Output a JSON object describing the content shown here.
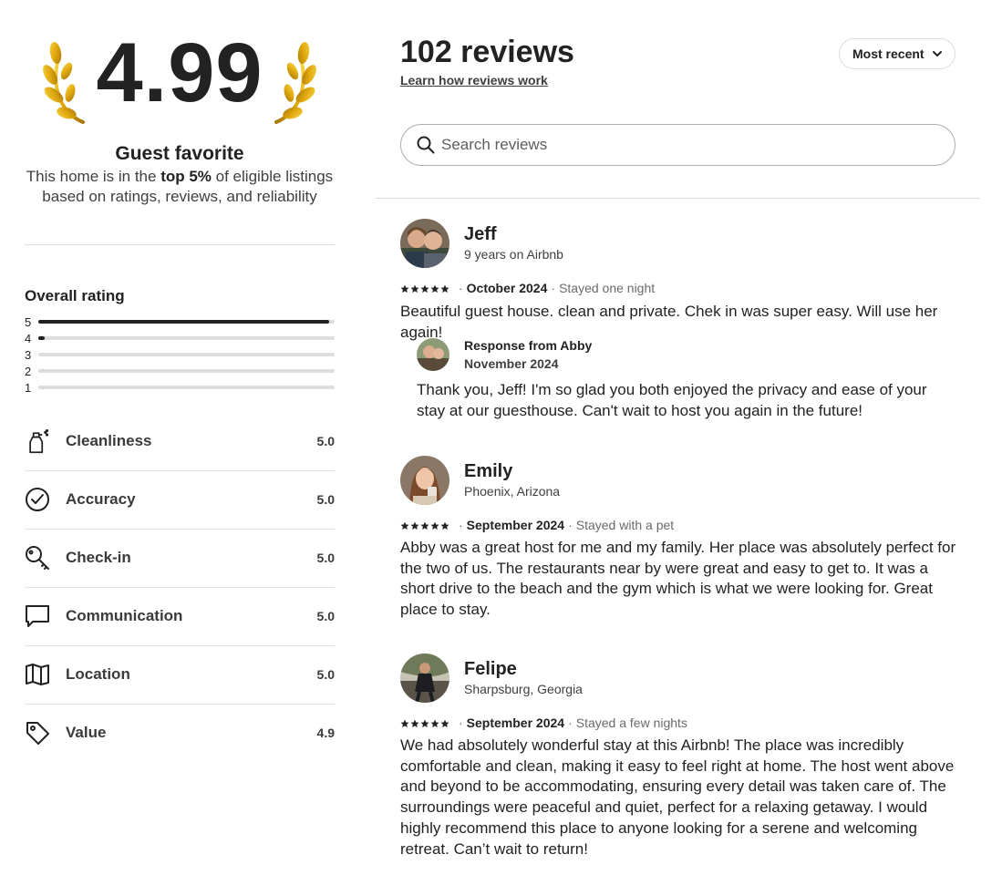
{
  "summary": {
    "rating": "4.99",
    "title": "Guest favorite",
    "desc_part1": "This home is in the ",
    "desc_bold": "top 5%",
    "desc_part2": " of eligible listings based on ratings, reviews, and reliability"
  },
  "overall": {
    "title": "Overall rating",
    "bars": [
      {
        "label": "5",
        "fraction": 0.98
      },
      {
        "label": "4",
        "fraction": 0.02
      },
      {
        "label": "3",
        "fraction": 0
      },
      {
        "label": "2",
        "fraction": 0
      },
      {
        "label": "1",
        "fraction": 0
      }
    ]
  },
  "categories": [
    {
      "label": "Cleanliness",
      "value": "5.0",
      "icon": "spray-bottle-icon"
    },
    {
      "label": "Accuracy",
      "value": "5.0",
      "icon": "check-circle-icon"
    },
    {
      "label": "Check-in",
      "value": "5.0",
      "icon": "key-icon"
    },
    {
      "label": "Communication",
      "value": "5.0",
      "icon": "chat-bubble-icon"
    },
    {
      "label": "Location",
      "value": "5.0",
      "icon": "map-icon"
    },
    {
      "label": "Value",
      "value": "4.9",
      "icon": "tag-icon"
    }
  ],
  "header": {
    "count": "102 reviews",
    "learn_link": "Learn how reviews work",
    "sort_label": "Most recent"
  },
  "search": {
    "placeholder": "Search reviews"
  },
  "reviews": [
    {
      "name": "Jeff",
      "sub": "9 years on Airbnb",
      "date": "October 2024",
      "stay": "Stayed one night",
      "text": "Beautiful guest house. clean and private. Chek in was super easy. Will use her again!",
      "response": {
        "from": "Response from Abby",
        "date": "November 2024",
        "text": "Thank you, Jeff! I'm so glad you both enjoyed the privacy and ease of your stay at our guesthouse. Can't wait to host you again in the future!"
      }
    },
    {
      "name": "Emily",
      "sub": "Phoenix, Arizona",
      "date": "September 2024",
      "stay": "Stayed with a pet",
      "text": "Abby was a great host for me and my family. Her place was absolutely perfect for the two of us. The restaurants near by were great and easy to get to. It was a short drive to the beach and the gym which is what we were looking for. Great place to stay."
    },
    {
      "name": "Felipe",
      "sub": "Sharpsburg, Georgia",
      "date": "September 2024",
      "stay": "Stayed a few nights",
      "text": "We had absolutely wonderful stay at this Airbnb! The place was incredibly comfortable and clean, making it easy to feel right at home. The host went above and beyond to be accommodating, ensuring every detail was taken care of. The surroundings were peaceful and quiet, perfect for a relaxing getaway. I would highly recommend this place to anyone looking for a serene and welcoming retreat. Can’t wait to return!"
    }
  ],
  "colors": {
    "text": "#222222",
    "muted": "#6a6a6a",
    "divider": "#dddddd",
    "laurel_gold": "#e2a910"
  }
}
